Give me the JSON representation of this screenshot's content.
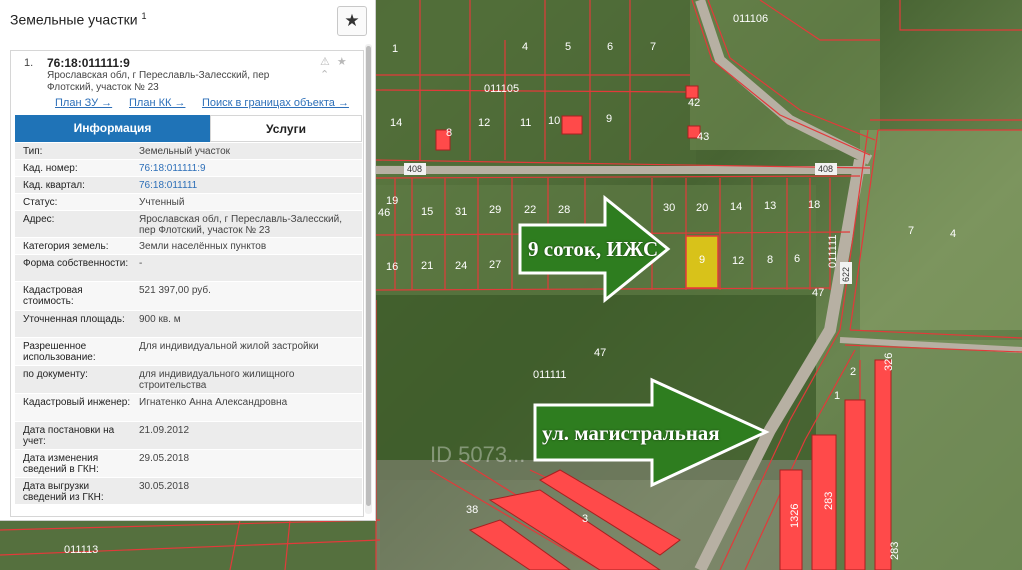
{
  "panel": {
    "title": "Земельные участки",
    "title_sup": "1",
    "favorite_icon": "★"
  },
  "card": {
    "index": "1.",
    "cad_number": "76:18:011111:9",
    "address_line1": "Ярославская обл, г Переславль-Залесский, пер",
    "address_line2": "Флотский, участок № 23",
    "icons": "⚠ ★ ⌃",
    "links": {
      "plan_zu": "План ЗУ →",
      "plan_kk": "План КК →",
      "search": "Поиск в границах объекта →"
    },
    "tabs": {
      "info": "Информация",
      "services": "Услуги"
    },
    "rows": [
      {
        "label": "Тип:",
        "value": "Земельный участок",
        "h": 17
      },
      {
        "label": "Кад. номер:",
        "value": "76:18:011111:9",
        "h": 17,
        "link": true
      },
      {
        "label": "Кад. квартал:",
        "value": "76:18:011111",
        "h": 17,
        "link": true
      },
      {
        "label": "Статус:",
        "value": "Учтенный",
        "h": 17
      },
      {
        "label": "Адрес:",
        "value": "Ярославская обл, г Переславль-Залесский, пер Флотский, участок № 23",
        "h": 27
      },
      {
        "label": "Категория земель:",
        "value": "Земли населённых пунктов",
        "h": 17
      },
      {
        "label": "Форма собственности:",
        "value": "-",
        "h": 27
      },
      {
        "label": "Кадастровая стоимость:",
        "value": "521 397,00 руб.",
        "h": 29
      },
      {
        "label": "Уточненная площадь:",
        "value": "900 кв. м",
        "h": 27
      },
      {
        "label": "Разрешенное использование:",
        "value": "Для индивидуальной жилой застройки",
        "h": 28
      },
      {
        "label": "по документу:",
        "value": "для индивидуального жилищного строительства",
        "h": 28
      },
      {
        "label": "Кадастровый инженер:",
        "value": "Игнатенко Анна Александровна",
        "h": 28
      },
      {
        "label": "Дата постановки на учет:",
        "value": "21.09.2012",
        "h": 28
      },
      {
        "label": "Дата изменения сведений в ГКН:",
        "value": "29.05.2018",
        "h": 28
      },
      {
        "label": "Дата выгрузки сведений из ГКН:",
        "value": "30.05.2018",
        "h": 27
      }
    ]
  },
  "map": {
    "callout_plot": "9 соток, ИЖС",
    "callout_road": "ул. магистральная",
    "block_labels": [
      "011106",
      "011105",
      "011111",
      "011113",
      "011111"
    ],
    "road_labels": [
      "408",
      "408",
      "622"
    ],
    "watermark": "ID 5073...",
    "plot_numbers": [
      "1",
      "4",
      "5",
      "6",
      "7",
      "14",
      "12",
      "11",
      "10",
      "9",
      "8",
      "42",
      "43",
      "19",
      "46",
      "15",
      "31",
      "29",
      "22",
      "28",
      "30",
      "20",
      "14",
      "13",
      "18",
      "16",
      "21",
      "24",
      "27",
      "9",
      "12",
      "8",
      "6",
      "47",
      "47",
      "7",
      "4",
      "38",
      "3",
      "1",
      "2",
      "326",
      "1326",
      "283",
      "283"
    ],
    "colors": {
      "parcel_line": "#e23a3a",
      "selected_parcel": "#d8c21a",
      "building": "#ff4a4a",
      "arrow_fill": "#2e7d1f",
      "arrow_stroke": "#ffffff"
    }
  }
}
